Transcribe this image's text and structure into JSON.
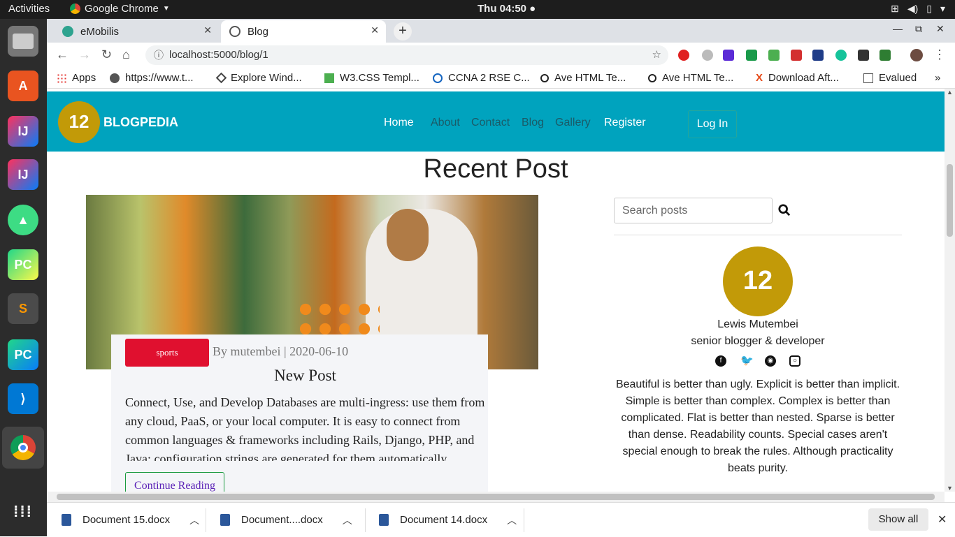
{
  "system": {
    "activities": "Activities",
    "app_name": "Google Chrome",
    "clock": "Thu 04:50 ●",
    "tray": [
      "network-icon",
      "volume-icon",
      "battery-icon",
      "power-menu-icon"
    ]
  },
  "dock": [
    "file-manager-icon",
    "software-center-icon",
    "intellij-icon",
    "intellij-icon",
    "android-studio-icon",
    "pycharm-icon",
    "sublime-text-icon",
    "pycharm-edu-icon",
    "vscode-icon",
    "chrome-icon",
    "show-apps-icon"
  ],
  "tabs": [
    {
      "title": "eMobilis",
      "active": false
    },
    {
      "title": "Blog",
      "active": true
    }
  ],
  "toolbar": {
    "url": "localhost:5000/blog/1"
  },
  "bookmarks": [
    {
      "label": "Apps",
      "icon": "apps-icon"
    },
    {
      "label": "https://www.t...",
      "icon": "globe-icon"
    },
    {
      "label": "Explore Wind...",
      "icon": "diamond-icon"
    },
    {
      "label": "W3.CSS Templ...",
      "icon": "w3-icon"
    },
    {
      "label": "CCNA 2 RSE C...",
      "icon": "cisco-icon"
    },
    {
      "label": "Ave HTML Te...",
      "icon": "ave-icon"
    },
    {
      "label": "Ave HTML Te...",
      "icon": "ave-icon"
    },
    {
      "label": "Download Aft...",
      "icon": "x-icon"
    },
    {
      "label": "Evalued",
      "icon": "doc-icon"
    }
  ],
  "site": {
    "logo_text": "12",
    "brand": "BLOGPEDIA",
    "nav": [
      "Home",
      "About",
      "Contact",
      "Blog",
      "Gallery",
      "Register"
    ],
    "login": "Log In",
    "heading": "Recent Post"
  },
  "post": {
    "category": "sports",
    "meta": "By mutembei | 2020-06-10",
    "title": "New Post",
    "body": "Connect, Use, and Develop Databases are multi-ingress: use them from any cloud, PaaS, or your local computer. It is easy to connect from common languages & frameworks including Rails, Django, PHP, and Java: configuration strings are generated for them automatically.",
    "cta": "Continue Reading"
  },
  "sidebar": {
    "search_placeholder": "Search posts",
    "author_logo_text": "12",
    "author_name": "Lewis Mutembei",
    "author_role": "senior blogger & developer",
    "socials": [
      "facebook-icon",
      "twitter-icon",
      "github-icon",
      "instagram-icon"
    ],
    "bio": "Beautiful is better than ugly. Explicit is better than implicit. Simple is better than complex. Complex is better than complicated. Flat is better than nested. Sparse is better than dense. Readability counts. Special cases aren't special enough to break the rules. Although practicality beats purity."
  },
  "downloads": {
    "items": [
      "Document 15.docx",
      "Document....docx",
      "Document 14.docx"
    ],
    "show_all": "Show all"
  }
}
